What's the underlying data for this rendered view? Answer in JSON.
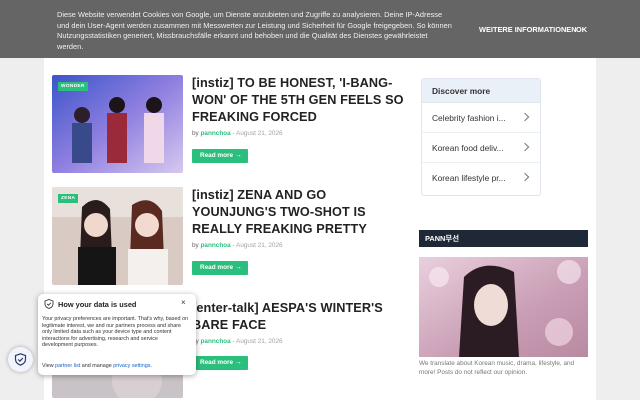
{
  "cookie_bar": {
    "text": "Diese Website verwendet Cookies von Google, um Dienste anzubieten und Zugriffe zu analysieren. Deine IP-Adresse und dein User-Agent werden zusammen mit Messwerten zur Leistung und Sicherheit für Google freigegeben. So können Nutzungsstatistiken generiert, Missbrauchsfälle erkannt und behoben und die Qualität des Dienstes gewährleistet werden.",
    "more_info": "WEITERE INFORMATIONEN",
    "ok": "OK"
  },
  "posts": [
    {
      "tag": "WONDER",
      "title": "[instiz] TO BE HONEST, 'I-BANG-WON' OF THE 5TH GEN FEELS SO FREAKING FORCED",
      "by": "by",
      "author": "pannchoa",
      "date": "- August 21, 2026",
      "read_more": "Read more",
      "arrow": "→"
    },
    {
      "tag": "ZENA",
      "title": "[instiz] ZENA AND GO YOUNJUNG'S TWO-SHOT IS REALLY FREAKING PRETTY",
      "by": "by",
      "author": "pannchoa",
      "date": "- August 21, 2026",
      "read_more": "Read more",
      "arrow": "→"
    },
    {
      "tag": "",
      "title": "[enter-talk] AESPA'S WINTER'S BARE FACE",
      "by": "by",
      "author": "pannchoa",
      "date": "- August 21, 2026",
      "read_more": "Read more",
      "arrow": "→"
    }
  ],
  "discover": {
    "title": "Discover more",
    "items": [
      {
        "label": "Celebrity fashion i...",
        "icon": "chevron-right-icon"
      },
      {
        "label": "Korean food deliv...",
        "icon": "chevron-right-icon"
      },
      {
        "label": "Korean lifestyle pr...",
        "icon": "chevron-right-icon"
      }
    ]
  },
  "widget": {
    "title": "PANN무선",
    "description": "We translate about Korean music, drama, lifestyle, and more! Posts do not reflect our opinion."
  },
  "privacy": {
    "title": "How your data is used",
    "close": "×",
    "body": "Your privacy preferences are important. That's why, based on legitimate interest, we and our partners process and share only limited data such as your device type and content interactions for advertising, research and service development purposes.",
    "view": "View",
    "partner_list": "partner list",
    "and_manage": "and manage",
    "privacy_settings": "privacy settings",
    "period": "."
  },
  "colors": {
    "accent": "#2bbf7d",
    "cookie_bg": "#656565",
    "widget_head": "#1f2837",
    "link": "#1a5fc8"
  }
}
